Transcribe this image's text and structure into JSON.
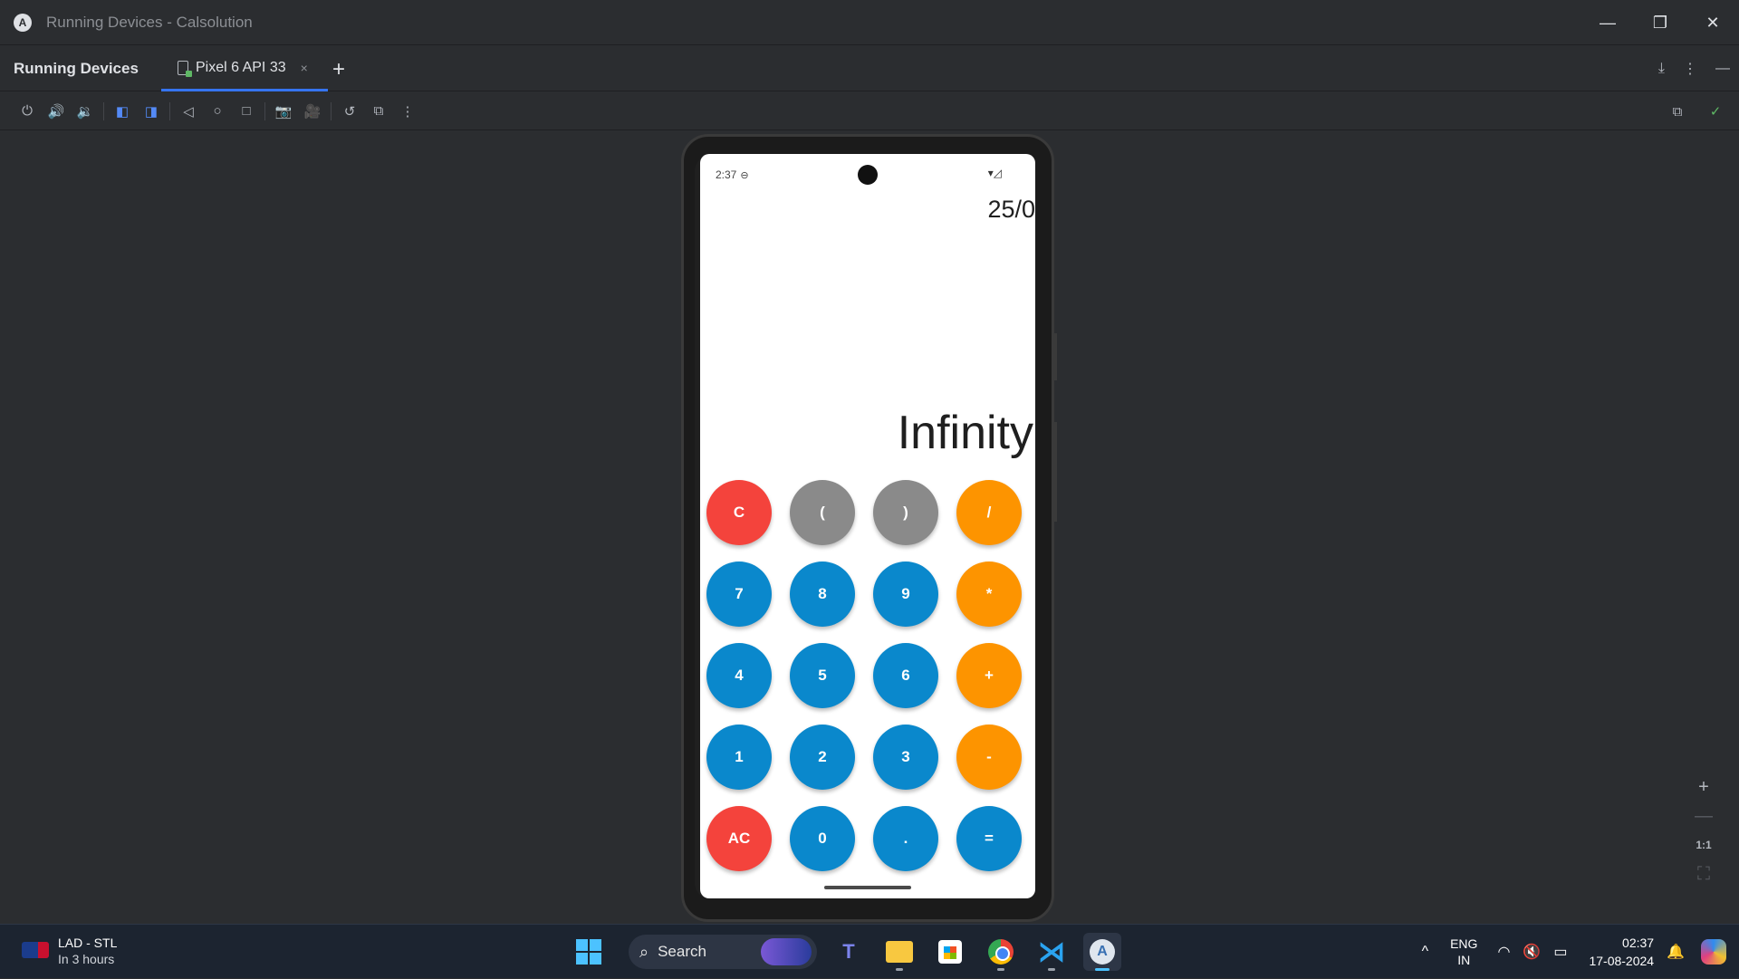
{
  "window": {
    "app_logo": "A",
    "title": "Running Devices - Calsolution",
    "controls": [
      "—",
      "❐",
      "✕"
    ]
  },
  "tool_window": {
    "title": "Running Devices",
    "tab_label": "Pixel 6 API 33",
    "tab_close": "×",
    "add_tab": "+",
    "right_icons": [
      "⤓",
      "⋮",
      "—"
    ]
  },
  "toolbar": {
    "icons": [
      "power-icon",
      "volume-up-icon",
      "volume-down-icon",
      "rotate-left-icon",
      "rotate-right-icon",
      "back-icon",
      "home-icon",
      "overview-icon",
      "screenshot-icon",
      "screen-record-icon",
      "reset-icon",
      "virtual-scene-icon",
      "more-icon"
    ],
    "glyphs": [
      "⏻",
      "🔊",
      "🔉",
      "◧",
      "◨",
      "◁",
      "○",
      "□",
      "📷",
      "🎥",
      "↺",
      "⧉",
      "⋮"
    ],
    "right_glyphs": [
      "⧉",
      "✓"
    ]
  },
  "phone": {
    "time": "2:37",
    "status_icons": "▾◿",
    "expression": "25/0",
    "result": "Infinity",
    "keys": [
      [
        "C",
        "(",
        ")",
        "/"
      ],
      [
        "7",
        "8",
        "9",
        "*"
      ],
      [
        "4",
        "5",
        "6",
        "+"
      ],
      [
        "1",
        "2",
        "3",
        "-"
      ],
      [
        "AC",
        "0",
        ".",
        "="
      ]
    ]
  },
  "zoom": {
    "plus": "+",
    "minus": "—",
    "one_to_one": "1:1",
    "fit": "⛶"
  },
  "taskbar": {
    "weather_title": "LAD - STL",
    "weather_sub": "In 3 hours",
    "search_placeholder": "Search",
    "search_glyph": "⌕",
    "teams_glyph": "T",
    "vscode_glyph": "⋊",
    "studio_glyph": "A",
    "chevron": "^",
    "lang_1": "ENG",
    "lang_2": "IN",
    "wifi": "◠",
    "volume": "🔇",
    "battery": "▭",
    "time": "02:37",
    "date": "17-08-2024",
    "bell": "🔔"
  },
  "colors": {
    "red": "#f4433c",
    "gray": "#8a8a8a",
    "blue": "#0a88cc",
    "orange": "#fd9400",
    "accent": "#3574f0"
  }
}
